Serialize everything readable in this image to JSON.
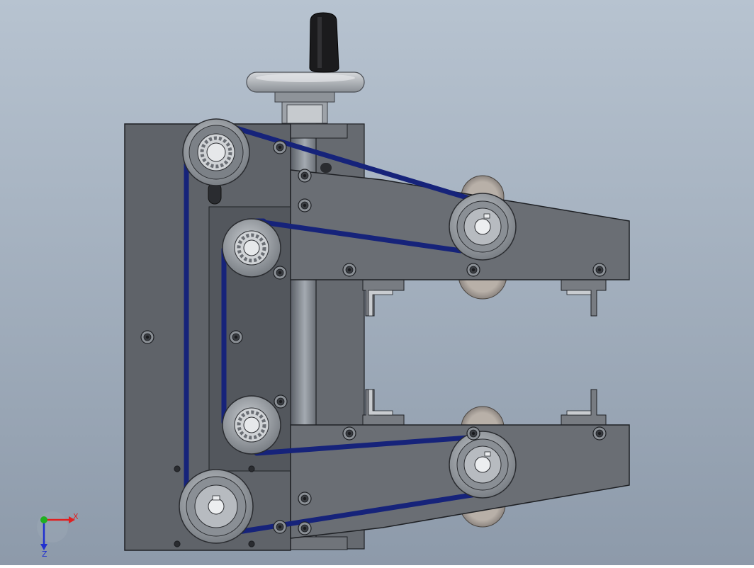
{
  "viewport": {
    "background_top": "#B7C3D0",
    "background_bottom": "#8D9AAA"
  },
  "triad": {
    "x_label": "X",
    "z_label": "Z",
    "x_color": "#E02020",
    "y_color": "#20B020",
    "z_color": "#2030D0"
  },
  "colors": {
    "plate": "#5F6369",
    "plate_dark": "#4A4E54",
    "plate_edge": "#1E2024",
    "arm": "#6A6E74",
    "belt": "#16237A",
    "belt_highlight": "#2C3DA8",
    "metal": "#B9BDC2",
    "metal_dark": "#7E8389",
    "handle": "#1B1B1D",
    "rod": "#8E949B"
  },
  "icons": {
    "bearing": "bearing-pulley-icon",
    "keyed_pulley": "keyed-pulley-icon",
    "screw": "socket-screw-icon",
    "handle": "knob-handle-icon"
  }
}
